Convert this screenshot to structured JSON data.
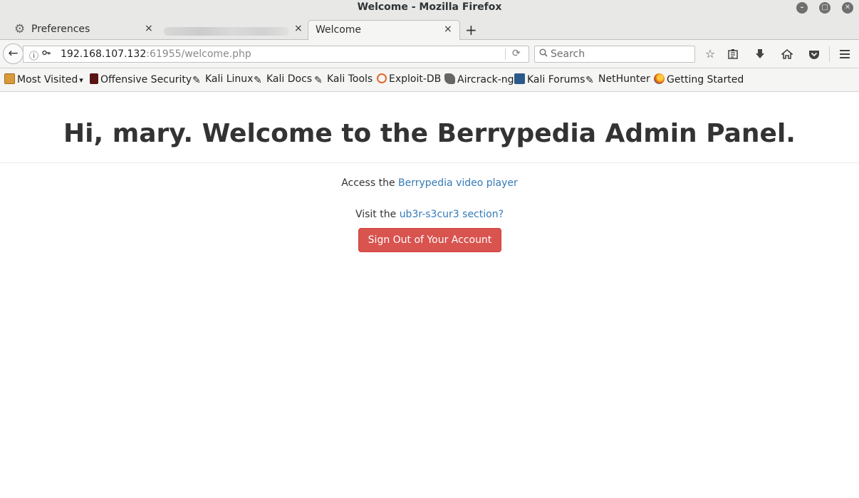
{
  "window": {
    "title": "Welcome - Mozilla Firefox",
    "minimize_glyph": "–",
    "maximize_glyph": "□",
    "close_glyph": "✕"
  },
  "tabs": [
    {
      "label": "Preferences",
      "icon": "gear-icon",
      "close": "×"
    },
    {
      "label": "",
      "icon": "blurred-tab",
      "close": "×"
    },
    {
      "label": "Welcome",
      "icon": "",
      "close": "×"
    }
  ],
  "new_tab_glyph": "+",
  "navbar": {
    "back_glyph": "←",
    "info_glyph": "ⓘ",
    "url_host": "192.168.107.132",
    "url_rest": ":61955/welcome.php",
    "reload_glyph": "⟳",
    "search_placeholder": "Search",
    "search_icon": "magnifier-icon",
    "tools": [
      "star-icon",
      "reading-list-icon",
      "download-icon",
      "home-icon",
      "pocket-icon",
      "menu-icon"
    ]
  },
  "bookmarks": [
    {
      "label": "Most Visited",
      "icon": "folder-icon",
      "color": "#c9822a"
    },
    {
      "label": "Offensive Security",
      "icon": "offsec-icon",
      "color": "#7a1a1a"
    },
    {
      "label": "Kali Linux",
      "icon": "kali-dragon-icon",
      "color": "#222222"
    },
    {
      "label": "Kali Docs",
      "icon": "kali-dragon-icon",
      "color": "#222222"
    },
    {
      "label": "Kali Tools",
      "icon": "kali-dragon-icon",
      "color": "#222222"
    },
    {
      "label": "Exploit-DB",
      "icon": "exploitdb-icon",
      "color": "#e06a2a"
    },
    {
      "label": "Aircrack-ng",
      "icon": "aircrack-icon",
      "color": "#555555"
    },
    {
      "label": "Kali Forums",
      "icon": "kali-forums-icon",
      "color": "#2a5a8a"
    },
    {
      "label": "NetHunter",
      "icon": "kali-dragon-icon",
      "color": "#222222"
    },
    {
      "label": "Getting Started",
      "icon": "firefox-icon",
      "color": "#e66000"
    }
  ],
  "page": {
    "greeting_prefix": "Hi, ",
    "username": "mary",
    "greeting_suffix": ". Welcome to the Berrypedia Admin Panel.",
    "line1_text": "Access the ",
    "line1_link": "Berrypedia video player",
    "line2_text": "Visit the ",
    "line2_link": "ub3r-s3cur3 section?",
    "signout_label": "Sign Out of Your Account",
    "colors": {
      "link": "#337ab7",
      "danger": "#d9534f"
    }
  }
}
